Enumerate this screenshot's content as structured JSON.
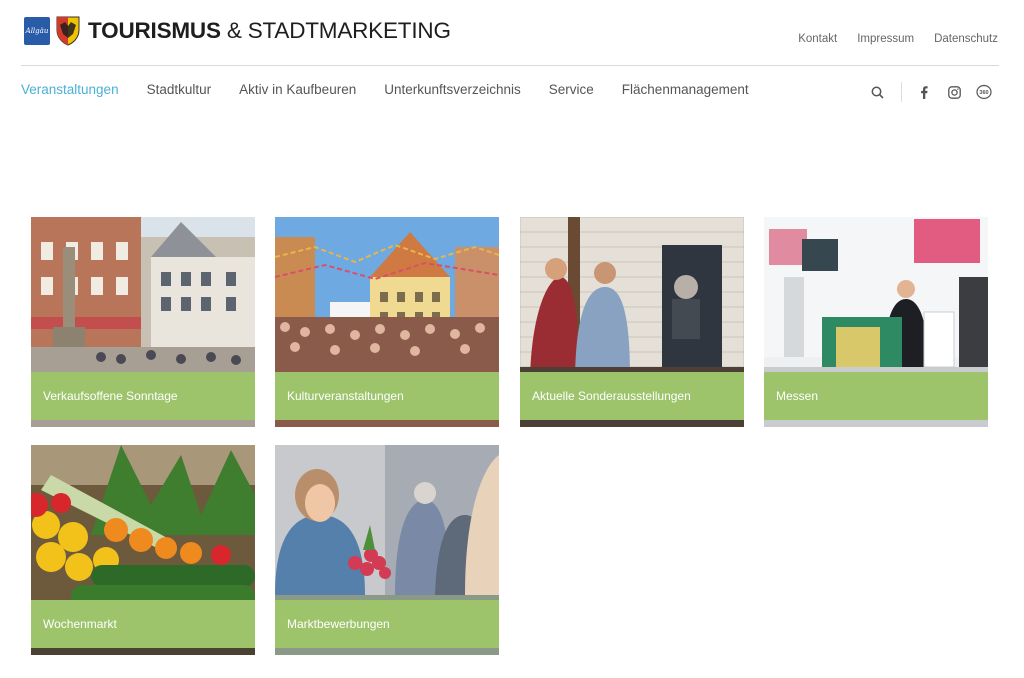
{
  "brand": {
    "allgaeu_logo_text": "Allgäu",
    "title_bold": "TOURISMUS",
    "title_thin": " & STADTMARKETING"
  },
  "top_links": [
    "Kontakt",
    "Impressum",
    "Datenschutz"
  ],
  "nav": {
    "items": [
      "Veranstaltungen",
      "Stadtkultur",
      "Aktiv in Kaufbeuren",
      "Unterkunftsverzeichnis",
      "Service",
      "Flächenmanagement"
    ],
    "active": "Veranstaltungen"
  },
  "icons": [
    "search-icon",
    "facebook-icon",
    "instagram-icon",
    "360-icon"
  ],
  "colors": {
    "accent": "#4bb0d6",
    "tile_label_bg": "#9dc46b"
  },
  "tiles": [
    {
      "label": "Verkaufsoffene Sonntage"
    },
    {
      "label": "Kulturveranstaltungen"
    },
    {
      "label": "Aktuelle Sonderausstellungen"
    },
    {
      "label": "Messen"
    },
    {
      "label": "Wochenmarkt"
    },
    {
      "label": "Marktbewerbungen"
    }
  ]
}
